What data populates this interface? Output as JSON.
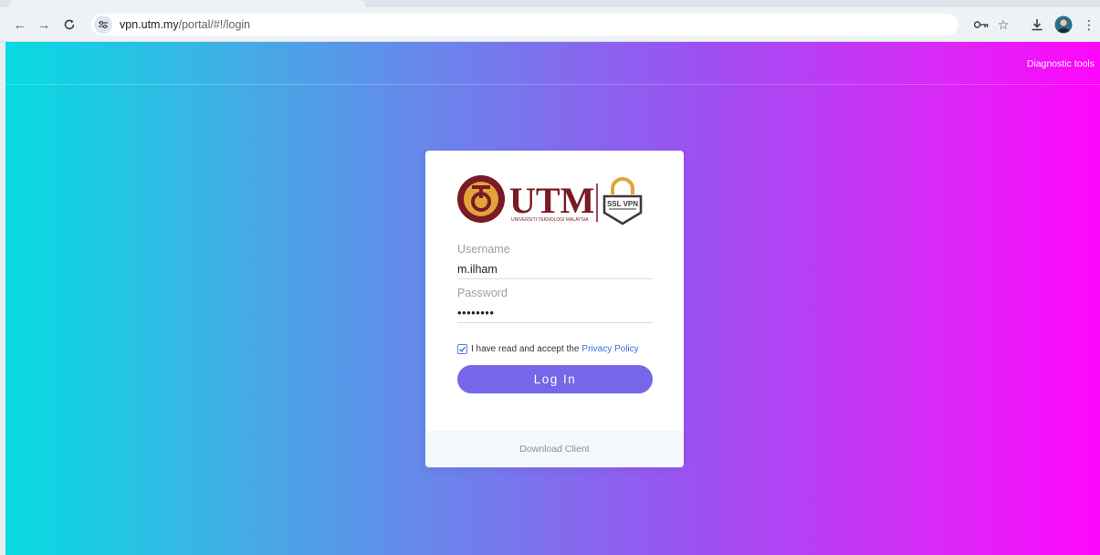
{
  "browser": {
    "url_host": "vpn.utm.my",
    "url_path": "/portal/#!/login"
  },
  "header": {
    "diagnostic_link": "Diagnostic tools"
  },
  "login": {
    "logo_text": "UTM",
    "logo_subtext": "UNIVERSITI TEKNOLOGI MALAYSIA",
    "badge_text": "SSL VPN",
    "username_label": "Username",
    "username_value": "m.ilham",
    "password_label": "Password",
    "password_value": "••••••••",
    "policy_text": "I have read and accept the",
    "policy_link": "Privacy Policy",
    "policy_checked": true,
    "login_button": "Log In",
    "download_link": "Download Client"
  },
  "colors": {
    "brand_maroon": "#7a1a24",
    "brand_gold": "#e2a43a",
    "button": "#7667ea",
    "link": "#3b6fd8"
  }
}
